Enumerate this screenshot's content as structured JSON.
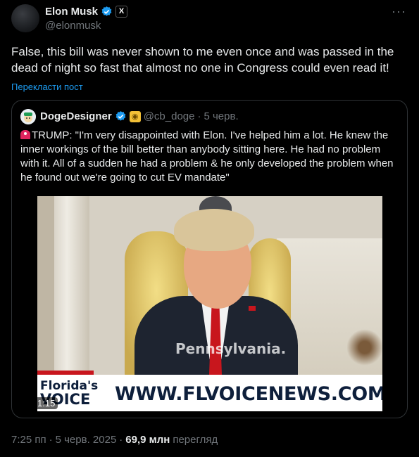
{
  "author": {
    "name": "Elon Musk",
    "handle": "@elonmusk",
    "verified_icon": "verified-badge-icon",
    "affiliation_badge": "X"
  },
  "tweet": {
    "text": "False, this bill was never shown to me even once and was passed in the dead of night so fast that almost no one in Congress could even read it!",
    "translate_label": "Перекласти пост"
  },
  "quote": {
    "name": "DogeDesigner",
    "handle": "@cb_doge",
    "date": "5 черв.",
    "separator": "·",
    "text": "TRUMP: \"I'm very disappointed with Elon. I've helped him a lot. He knew the inner workings of the bill better than anybody sitting here. He had no problem with it. All of a sudden he had a problem & he only developed the problem when he found out we're going to cut EV mandate\"",
    "video": {
      "caption": "Pennsylvania.",
      "logo_line1": "Florida's",
      "logo_line2": "VOICE",
      "site": "WWW.FLVOICENEWS.COM",
      "duration": "1:15"
    }
  },
  "footer": {
    "time": "7:25 пп",
    "date": "5 черв. 2025",
    "separator": "·",
    "views_count": "69,9 млн",
    "views_label": "перегляд"
  },
  "more_label": "···",
  "colors": {
    "background": "#000000",
    "text": "#e7e9ea",
    "muted": "#71767b",
    "link": "#1d9bf0",
    "border": "#2f3336"
  }
}
